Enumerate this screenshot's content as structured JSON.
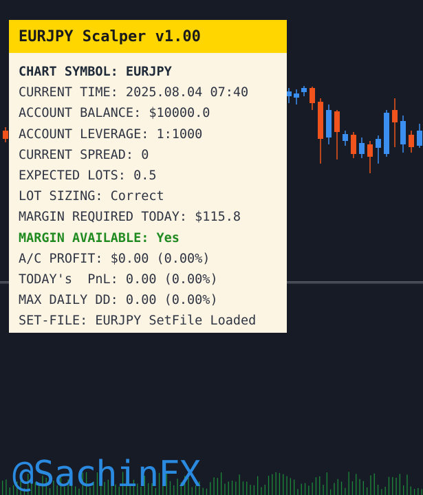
{
  "panel": {
    "title": "EURJPY Scalper v1.00",
    "rows": [
      {
        "text": "CHART SYMBOL: EURJPY",
        "style": "bold"
      },
      {
        "text": "CURRENT TIME: 2025.08.04 07:40",
        "style": "normal"
      },
      {
        "text": "ACCOUNT BALANCE: $10000.0",
        "style": "normal"
      },
      {
        "text": "ACCOUNT LEVERAGE: 1:1000",
        "style": "normal"
      },
      {
        "text": "CURRENT SPREAD: 0",
        "style": "normal"
      },
      {
        "text": "EXPECTED LOTS: 0.5",
        "style": "normal"
      },
      {
        "text": "LOT SIZING: Correct",
        "style": "normal"
      },
      {
        "text": "MARGIN REQUIRED TODAY: $115.8",
        "style": "normal"
      },
      {
        "text": "MARGIN AVAILABLE: Yes",
        "style": "green"
      },
      {
        "text": "A/C PROFIT: $0.00 (0.00%)",
        "style": "normal"
      },
      {
        "text": "TODAY's  PnL: 0.00 (0.00%)",
        "style": "normal"
      },
      {
        "text": "MAX DAILY DD: 0.00 (0.00%)",
        "style": "normal"
      },
      {
        "text": "SET-FILE: EURJPY SetFile Loaded",
        "style": "normal"
      }
    ]
  },
  "watermark": "@SachinFX",
  "colors": {
    "background": "#161b26",
    "panel_bg": "#fdf5e4",
    "header_bg": "#ffd600",
    "bull_candle": "#3b8ff0",
    "bear_candle": "#f0541c",
    "volume": "#1d8a3a",
    "margin_ok": "#1f8a1f",
    "watermark": "#2a8ae0"
  }
}
